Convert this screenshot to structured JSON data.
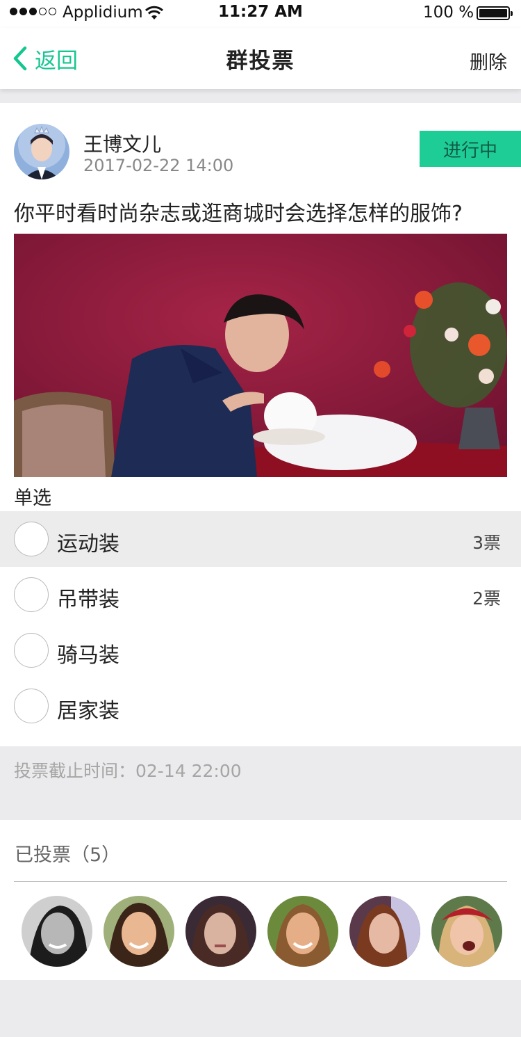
{
  "status_bar": {
    "carrier": "Applidium",
    "time": "11:27 AM",
    "battery": "100 %"
  },
  "nav": {
    "back_label": "返回",
    "title": "群投票",
    "delete_label": "删除"
  },
  "post": {
    "author": "王博文儿",
    "date": "2017-02-22   14:00",
    "status": "进行中",
    "question": "你平时看时尚杂志或逛商城时会选择怎样的服饰?",
    "vote_type": "单选"
  },
  "options": [
    {
      "label": "运动装",
      "count": "3票",
      "selected": true
    },
    {
      "label": "吊带装",
      "count": "2票",
      "selected": false
    },
    {
      "label": "骑马装",
      "count": "",
      "selected": false
    },
    {
      "label": "居家装",
      "count": "",
      "selected": false
    }
  ],
  "deadline": "投票截止时间：02-14 22:00",
  "voters": {
    "title": "已投票（5）",
    "count": 6
  },
  "colors": {
    "accent": "#16c691",
    "badge_bg": "#1ecd96",
    "page_bg": "#ebebed"
  }
}
